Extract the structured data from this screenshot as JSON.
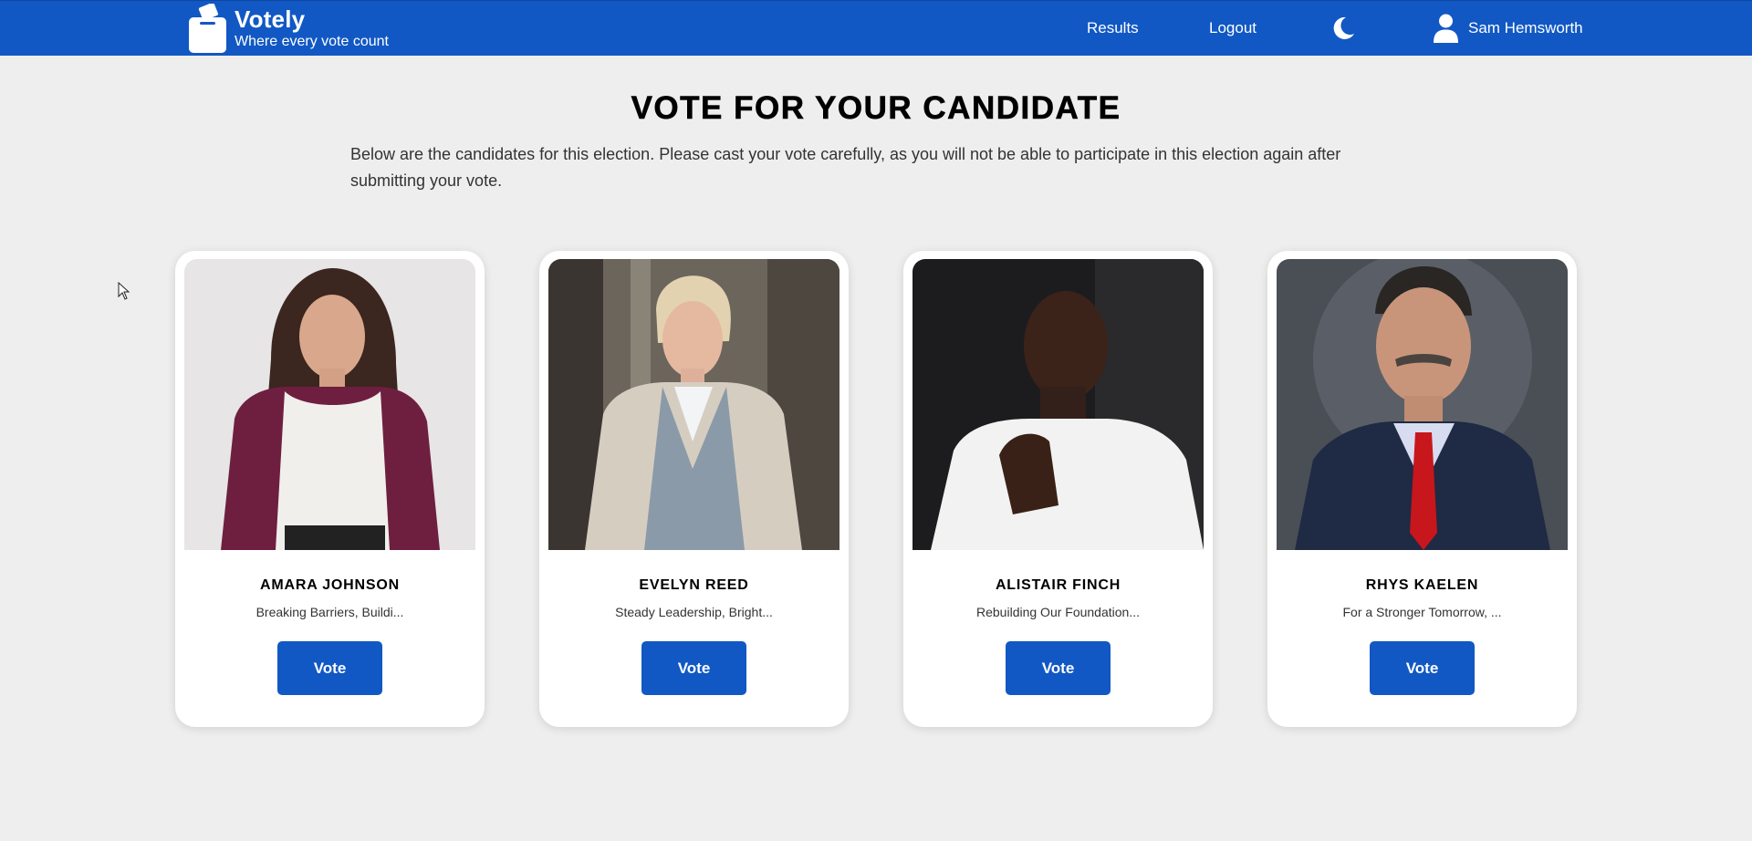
{
  "header": {
    "app_name": "Votely",
    "tagline": "Where every vote count",
    "nav": {
      "results_label": "Results",
      "logout_label": "Logout"
    },
    "theme_icon": "moon-icon",
    "user_icon": "user-icon",
    "user_name": "Sam Hemsworth"
  },
  "main": {
    "title": "VOTE FOR YOUR CANDIDATE",
    "intro": "Below are the candidates for this election. Please cast your vote carefully, as you will not be able to participate in this election again after submitting your vote.",
    "candidates": [
      {
        "name": "AMARA JOHNSON",
        "slogan": "Breaking Barriers, Buildi...",
        "vote_label": "Vote"
      },
      {
        "name": "EVELYN REED",
        "slogan": "Steady Leadership, Bright...",
        "vote_label": "Vote"
      },
      {
        "name": "ALISTAIR FINCH",
        "slogan": "Rebuilding Our Foundation...",
        "vote_label": "Vote"
      },
      {
        "name": "RHYS KAELEN",
        "slogan": "For a Stronger Tomorrow, ...",
        "vote_label": "Vote"
      }
    ]
  },
  "colors": {
    "brand": "#1158c4",
    "background": "#eeeeee",
    "card": "#ffffff"
  }
}
